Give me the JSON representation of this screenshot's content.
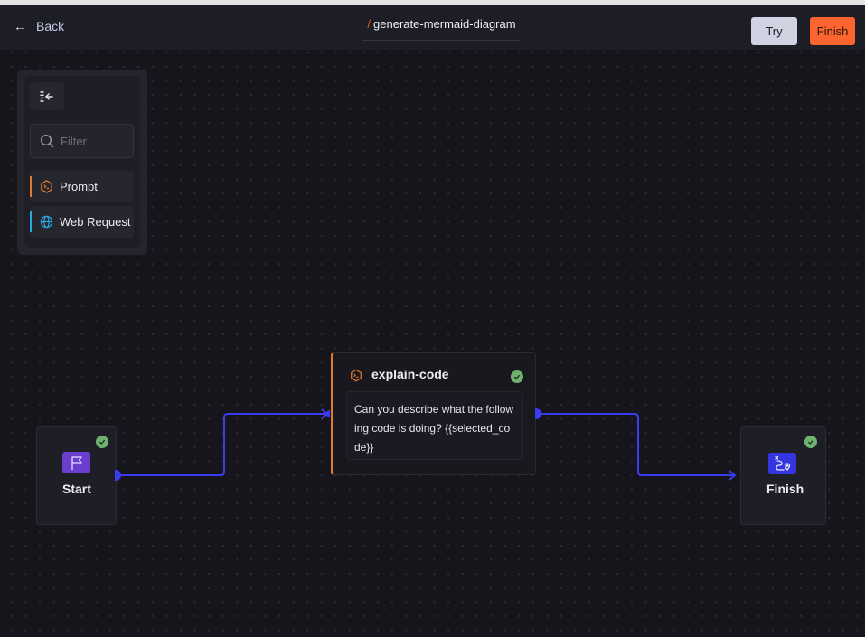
{
  "header": {
    "back_label": "Back",
    "title_prefix": "/",
    "title": "generate-mermaid-diagram",
    "try_label": "Try",
    "finish_label": "Finish"
  },
  "sidebar": {
    "collapse_icon": "collapse-left-icon",
    "filter": {
      "placeholder": "Filter",
      "value": ""
    },
    "items": [
      {
        "label": "Prompt",
        "icon": "prompt-hexagon-icon",
        "accent": "#e07a2e"
      },
      {
        "label": "Web Request",
        "icon": "globe-icon",
        "accent": "#29a8e0"
      }
    ]
  },
  "flow": {
    "nodes": [
      {
        "id": "start",
        "label": "Start",
        "icon": "flag-icon",
        "icon_color": "#6a3fd0",
        "status": "success"
      },
      {
        "id": "explain-code",
        "title": "explain-code",
        "icon": "prompt-hexagon-icon",
        "accent": "#e07a2e",
        "body": "Can you describe what the following code is doing? {{selected_code}}",
        "status": "success"
      },
      {
        "id": "finish",
        "label": "Finish",
        "icon": "route-icon",
        "icon_color": "#3434e0",
        "status": "success"
      }
    ],
    "edges": [
      {
        "from": "start",
        "to": "explain-code"
      },
      {
        "from": "explain-code",
        "to": "finish"
      }
    ],
    "edge_color": "#3b3bf0"
  }
}
